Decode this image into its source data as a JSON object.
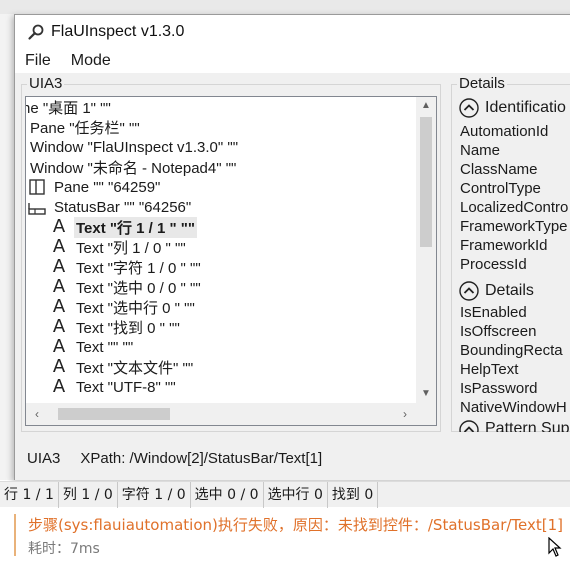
{
  "window": {
    "title": "FlaUInspect v1.3.0",
    "icon": "magnifier-icon"
  },
  "menu": {
    "items": [
      "File",
      "Mode"
    ]
  },
  "tree_panel": {
    "group_title": "UIA3",
    "rows": [
      {
        "text": "ne \"桌面 1\" \"\"",
        "icon": "none",
        "indent": 0,
        "selected": false
      },
      {
        "text": "Pane \"任务栏\" \"\"",
        "icon": "none",
        "indent": 1,
        "selected": false
      },
      {
        "text": "Window \"FlaUInspect v1.3.0\" \"\"",
        "icon": "none",
        "indent": 1,
        "selected": false
      },
      {
        "text": "Window \"未命名 - Notepad4\" \"\"",
        "icon": "none",
        "indent": 1,
        "selected": false
      },
      {
        "text": "Pane \"\" \"64259\"",
        "icon": "pane-icon",
        "indent": 2,
        "selected": false
      },
      {
        "text": "StatusBar \"\" \"64256\"",
        "icon": "statusbar-icon",
        "indent": 2,
        "selected": false
      },
      {
        "text": "Text \"行 1 / 1 \" \"\"",
        "icon": "text-icon",
        "indent": 3,
        "selected": true
      },
      {
        "text": "Text \"列 1 / 0 \" \"\"",
        "icon": "text-icon",
        "indent": 3,
        "selected": false
      },
      {
        "text": "Text \"字符 1 / 0 \" \"\"",
        "icon": "text-icon",
        "indent": 3,
        "selected": false
      },
      {
        "text": "Text \"选中 0 / 0 \" \"\"",
        "icon": "text-icon",
        "indent": 3,
        "selected": false
      },
      {
        "text": "Text \"选中行 0 \" \"\"",
        "icon": "text-icon",
        "indent": 3,
        "selected": false
      },
      {
        "text": "Text \"找到 0 \" \"\"",
        "icon": "text-icon",
        "indent": 3,
        "selected": false
      },
      {
        "text": "Text \"\" \"\"",
        "icon": "text-icon",
        "indent": 3,
        "selected": false
      },
      {
        "text": "Text \"文本文件\" \"\"",
        "icon": "text-icon",
        "indent": 3,
        "selected": false
      },
      {
        "text": "Text \"UTF-8\" \"\"",
        "icon": "text-icon",
        "indent": 3,
        "selected": false
      }
    ]
  },
  "details_panel": {
    "group_title": "Details",
    "sections": [
      {
        "title": "Identificatio",
        "icon": "collapse-up-icon",
        "properties": [
          "AutomationId",
          "Name",
          "ClassName",
          "ControlType",
          "LocalizedContro",
          "FrameworkType",
          "FrameworkId",
          "ProcessId"
        ]
      },
      {
        "title": "Details",
        "icon": "collapse-up-icon",
        "properties": [
          "IsEnabled",
          "IsOffscreen",
          "BoundingRecta",
          "HelpText",
          "IsPassword",
          "NativeWindowH"
        ]
      },
      {
        "title": "Pattern Sup",
        "icon": "collapse-up-icon",
        "properties": []
      }
    ]
  },
  "inspector_status": {
    "mode": "UIA3",
    "xpath": "XPath: /Window[2]/StatusBar/Text[1]"
  },
  "notepad_status": {
    "cells": [
      "行 1 / 1",
      "列 1 / 0",
      "字符 1 / 0",
      "选中 0 / 0",
      "选中行 0",
      "找到 0"
    ]
  },
  "log": {
    "error": "步骤(sys:flauiautomation)执行失败，原因：未找到控件：/StatusBar/Text[1]",
    "time": "耗时：7ms",
    "error_color": "#e0712a"
  }
}
